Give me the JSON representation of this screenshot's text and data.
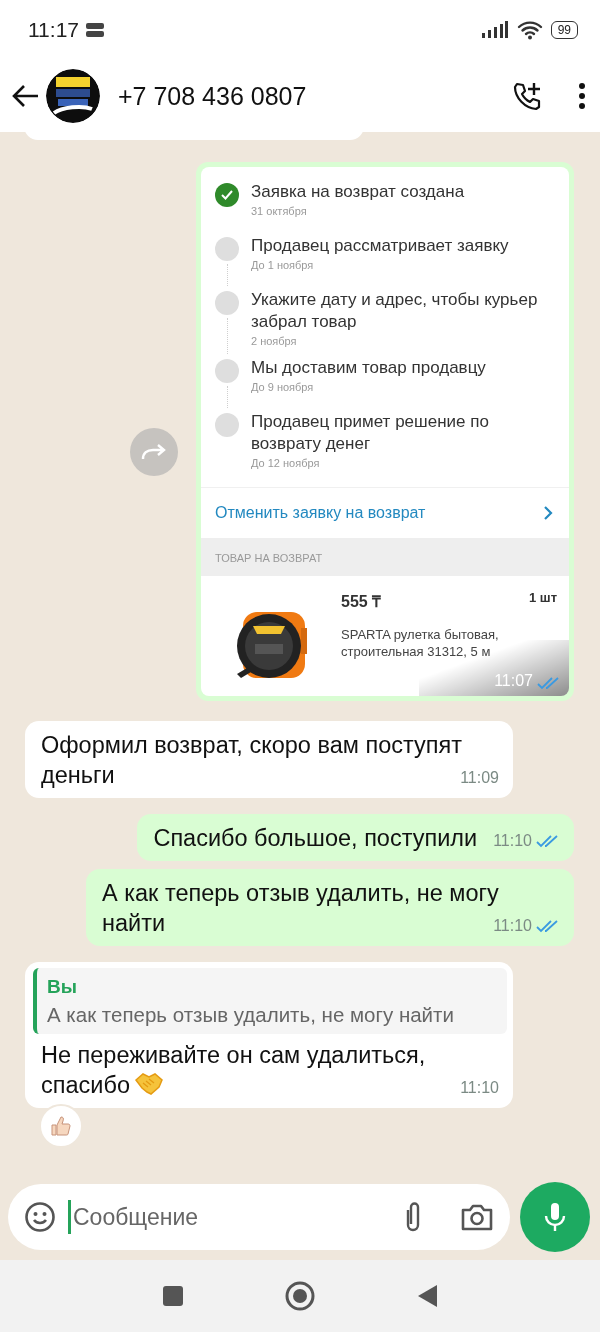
{
  "status_bar": {
    "time": "11:17",
    "battery": "99"
  },
  "header": {
    "title": "+7 708 436 0807"
  },
  "return_card": {
    "steps": [
      {
        "title": "Заявка на возврат создана",
        "date": "31 октября",
        "done": true
      },
      {
        "title": "Продавец рассматривает заявку",
        "date": "До 1 ноября",
        "done": false
      },
      {
        "title": "Укажите дату и адрес, чтобы курьер забрал товар",
        "date": "2 ноября",
        "done": false
      },
      {
        "title": "Мы доставим товар продавцу",
        "date": "До 9 ноября",
        "done": false
      },
      {
        "title": "Продавец примет решение по возврату денег",
        "date": "До 12 ноября",
        "done": false
      }
    ],
    "cancel_link": "Отменить заявку на возврат",
    "section_label": "ТОВАР НА ВОЗВРАТ",
    "product": {
      "price": "555 ₸",
      "quantity": "1 шт",
      "name": "SPARTA рулетка бытовая, строительная 31312, 5 м"
    },
    "time": "11:07",
    "read": true
  },
  "messages": [
    {
      "kind": "incoming",
      "text": "Оформил возврат, скоро вам поступят деньги",
      "time": "11:09"
    },
    {
      "kind": "outgoing",
      "text": "Спасибо большое, поступили",
      "time": "11:10",
      "read": true
    },
    {
      "kind": "outgoing",
      "text": "А как теперь отзыв удалить, не могу найти",
      "time": "11:10",
      "read": true
    },
    {
      "kind": "incoming",
      "quote": {
        "author": "Вы",
        "text": "А как теперь отзыв удалить, не могу найти"
      },
      "text": "Не переживайте он сам удалиться, спасибо",
      "handshake_emoji": true,
      "time": "11:10",
      "thumbs_up_reaction": true
    }
  ],
  "composer": {
    "placeholder": "Сообщение"
  }
}
